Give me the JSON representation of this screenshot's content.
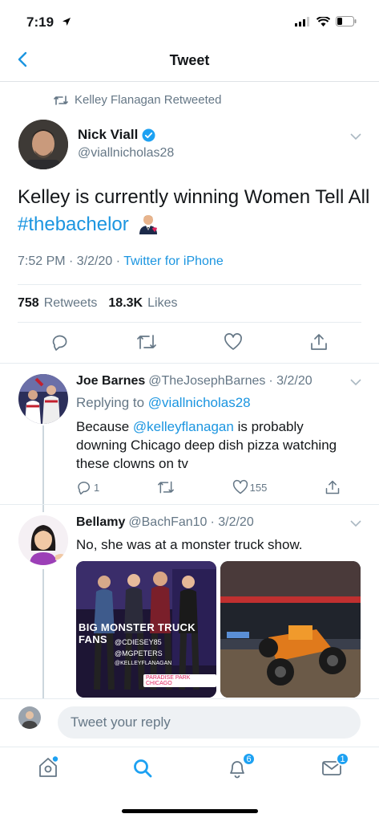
{
  "status_bar": {
    "time": "7:19"
  },
  "header": {
    "title": "Tweet"
  },
  "retweet_context": {
    "text": "Kelley Flanagan Retweeted"
  },
  "main_tweet": {
    "name": "Nick Viall",
    "handle": "@viallnicholas28",
    "text_plain": "Kelley is currently winning Women Tell All ",
    "hashtag": "#thebachelor",
    "time": "7:52 PM · 3/2/20 · ",
    "source": "Twitter for iPhone",
    "retweets_count": "758",
    "retweets_label": "Retweets",
    "likes_count": "18.3K",
    "likes_label": "Likes"
  },
  "replies": [
    {
      "name": "Joe Barnes",
      "handle": "@TheJosephBarnes",
      "date": "· 3/2/20",
      "replying_prefix": "Replying to",
      "replying_handle": "@viallnicholas28",
      "text_before": "Because ",
      "mention": "@kelleyflanagan",
      "text_after": " is probably downing Chicago deep dish pizza watching these clowns on tv",
      "reply_count": "1",
      "like_count": "155"
    },
    {
      "name": "Bellamy",
      "handle": "@BachFan10",
      "date": "· 3/2/20",
      "text": "No, she was at a monster truck show.",
      "photo1": {
        "caption": "BIG MONSTER TRUCK FANS",
        "tags": [
          "@CDIESEY85",
          "@MGPETERS",
          "@KELLEYFLANAGAN"
        ],
        "location": "PARADISE PARK CHICAGO"
      }
    }
  ],
  "reply_bar": {
    "placeholder": "Tweet your reply"
  },
  "tabbar": {
    "notifications_badge": "6",
    "messages_badge": "1"
  },
  "colors": {
    "accent": "#1b95e0",
    "muted": "#657786",
    "text": "#14171a"
  }
}
